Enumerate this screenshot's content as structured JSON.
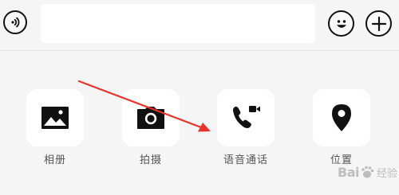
{
  "input_bar": {
    "voice_icon": "voice-input-icon",
    "text_placeholder": "",
    "emoji_icon": "smiley-icon",
    "plus_icon": "plus-icon"
  },
  "panel": {
    "items": [
      {
        "label": "相册",
        "icon": "photo-album-icon"
      },
      {
        "label": "拍摄",
        "icon": "camera-icon"
      },
      {
        "label": "语音通话",
        "icon": "voice-call-icon"
      },
      {
        "label": "位置",
        "icon": "location-pin-icon"
      }
    ]
  },
  "annotation": {
    "arrow_color": "#e8322c"
  },
  "watermark": {
    "brand": "Bai",
    "suffix": "经验"
  }
}
